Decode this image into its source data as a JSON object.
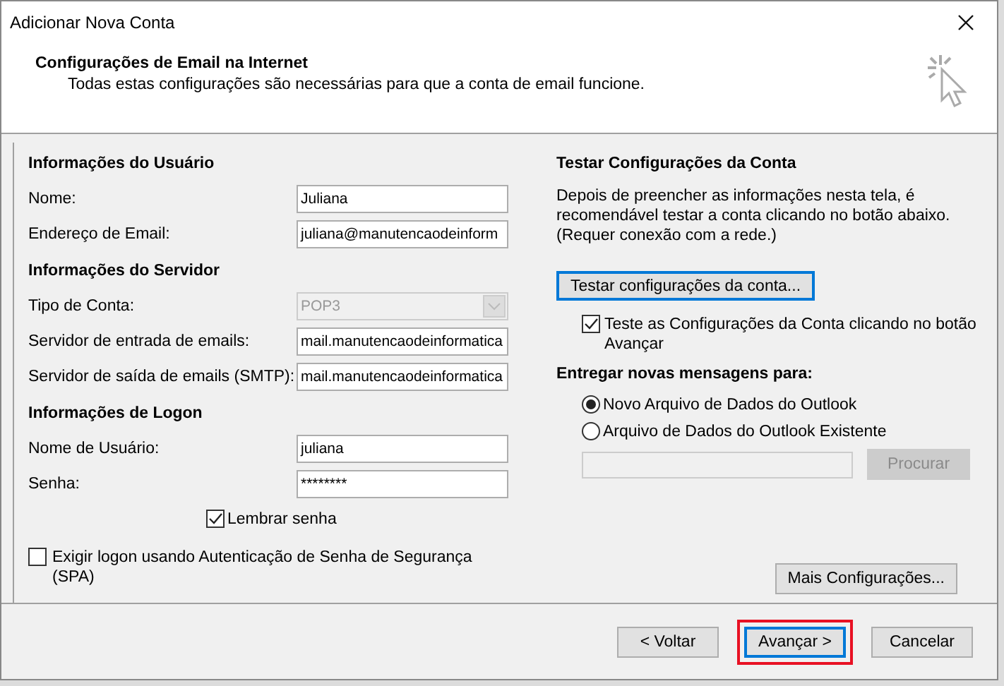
{
  "window": {
    "title": "Adicionar Nova Conta"
  },
  "header": {
    "title": "Configurações de Email na Internet",
    "subtitle": "Todas estas configurações são necessárias para que a conta de email funcione."
  },
  "left_sections": [
    {
      "title": "Informações do Usuário",
      "fields": [
        {
          "label": "Nome:",
          "value": "Juliana",
          "kind": "text",
          "disabled": false
        },
        {
          "label": "Endereço de Email:",
          "value": "juliana@manutencaodeinform",
          "kind": "text",
          "disabled": false
        }
      ]
    },
    {
      "title": "Informações do Servidor",
      "fields": [
        {
          "label": "Tipo de Conta:",
          "value": "POP3",
          "kind": "dropdown",
          "disabled": true
        },
        {
          "label": "Servidor de entrada de emails:",
          "value": "mail.manutencaodeinformatica",
          "kind": "text",
          "disabled": false
        },
        {
          "label": "Servidor de saída de emails (SMTP):",
          "value": "mail.manutencaodeinformatica",
          "kind": "text",
          "disabled": false
        }
      ]
    },
    {
      "title": "Informações de Logon",
      "fields": [
        {
          "label": "Nome de Usuário:",
          "value": "juliana",
          "kind": "text",
          "disabled": false
        },
        {
          "label": "Senha:",
          "value": "********",
          "kind": "text",
          "disabled": false
        }
      ]
    }
  ],
  "remember_password": {
    "label": "Lembrar senha",
    "checked": true
  },
  "spa": {
    "label": "Exigir logon usando Autenticação de Senha de Segurança (SPA)",
    "checked": false
  },
  "test_section": {
    "title": "Testar Configurações da Conta",
    "description": "Depois de preencher as informações nesta tela, é recomendável testar a conta clicando no botão abaixo. (Requer conexão com a rede.)",
    "button": "Testar configurações da conta...",
    "auto_test": {
      "label": "Teste as Configurações da Conta clicando no botão Avançar",
      "checked": true
    }
  },
  "deliver": {
    "title": "Entregar novas mensagens para:",
    "options": [
      {
        "label": "Novo Arquivo de Dados do Outlook",
        "selected": true
      },
      {
        "label": "Arquivo de Dados do Outlook Existente",
        "selected": false
      }
    ],
    "browse_button": "Procurar",
    "browse_disabled": true
  },
  "more_button": "Mais Configurações...",
  "buttons": [
    {
      "label": "< Voltar",
      "default": false,
      "highlighted": false
    },
    {
      "label": "Avançar >",
      "default": true,
      "highlighted": true
    },
    {
      "label": "Cancelar",
      "default": false,
      "highlighted": false
    }
  ]
}
